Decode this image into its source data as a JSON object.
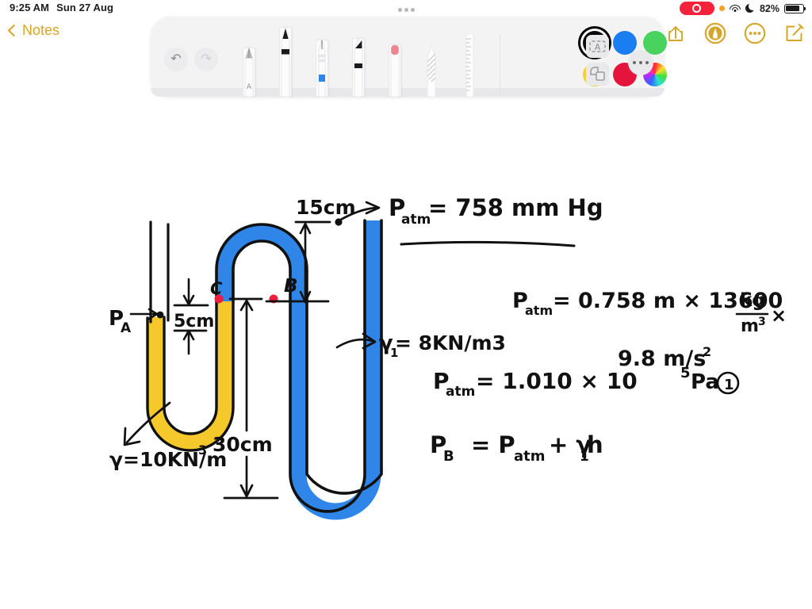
{
  "status_bar": {
    "time": "9:25 AM",
    "date": "Sun 27 Aug",
    "battery_percent": "82%",
    "icons": [
      "screen-recording-indicator",
      "orange-privacy-dot",
      "wifi-icon",
      "do-not-disturb-moon-icon",
      "battery-icon"
    ]
  },
  "nav": {
    "back_label": "Notes",
    "right_buttons": [
      {
        "name": "share-button",
        "icon": "share-icon"
      },
      {
        "name": "markup-button",
        "icon": "markup-pen-circle-icon"
      },
      {
        "name": "more-button",
        "icon": "ellipsis-circle-icon"
      },
      {
        "name": "compose-button",
        "icon": "compose-icon"
      }
    ]
  },
  "toolbar": {
    "handle": "drag-handle",
    "undo_label": "↶",
    "redo_label": "↷",
    "tools": [
      {
        "name": "fountain-pen-tool",
        "label": "A",
        "selected": false
      },
      {
        "name": "pen-tool",
        "label": "",
        "selected": true
      },
      {
        "name": "pencil-tool",
        "label": "",
        "selected": false
      },
      {
        "name": "marker-tool",
        "label": "",
        "selected": false
      },
      {
        "name": "eraser-tool",
        "label": "",
        "selected": false
      },
      {
        "name": "lasso-tool",
        "label": "",
        "selected": false
      },
      {
        "name": "ruler-tool",
        "label": "",
        "selected": false
      }
    ],
    "colors": [
      {
        "name": "color-black",
        "hex": "#0a0a0a",
        "selected": true
      },
      {
        "name": "color-blue",
        "hex": "#1a7ef0",
        "selected": false
      },
      {
        "name": "color-green",
        "hex": "#4ad25f",
        "selected": false
      },
      {
        "name": "color-yellow",
        "hex": "#f6cf32",
        "selected": false
      },
      {
        "name": "color-red",
        "hex": "#e5143c",
        "selected": false
      },
      {
        "name": "color-wheel",
        "hex": "#cc66ff",
        "selected": false
      }
    ],
    "text_box_label": "A",
    "layers_label": "",
    "more_label": "…"
  },
  "note": {
    "palette": {
      "ink": "#111111",
      "fluid_yellow": "#f5c92b",
      "fluid_blue": "#2f86e8",
      "marker_red": "#ee1f3d"
    },
    "diagram": {
      "labels": {
        "p_a": "P",
        "p_a_sub": "A",
        "point_c": "C",
        "point_b": "B",
        "dim_5cm": "5cm",
        "dim_15cm": "15cm",
        "dim_30cm": "30cm",
        "gamma_yellow": "γ=10KN/m",
        "gamma_yellow_exp": "3",
        "gamma_blue": "γ = 8KN/m3",
        "gamma_blue_main": "γ",
        "gamma_blue_sub": "1",
        "gamma_blue_rest": "= 8KN/m3"
      }
    },
    "work": {
      "line1_lhs": "P",
      "line1_sub": "atm",
      "line1_rhs": "= 758 mm Hg",
      "line2_lhs": "P",
      "line2_sub": "atm",
      "line2_rhs": "= 0.758 m × 13600",
      "line2_frac_num": "kg",
      "line2_frac_den": "m",
      "line2_frac_den_exp": "3",
      "line2_tail": "×",
      "line3": "9.8 m/s",
      "line3_exp": "2",
      "line4_lhs": "P",
      "line4_sub": "atm",
      "line4_rhs": "= 1.010 × 10",
      "line4_exp": "5",
      "line4_unit": "Pa",
      "line4_marker": "1",
      "line5_lhs": "P",
      "line5_sub": "B",
      "line5_mid": "= P",
      "line5_mid_sub": "atm",
      "line5_plus": "+ γ",
      "line5_gsub": "1",
      "line5_h": "h"
    }
  }
}
